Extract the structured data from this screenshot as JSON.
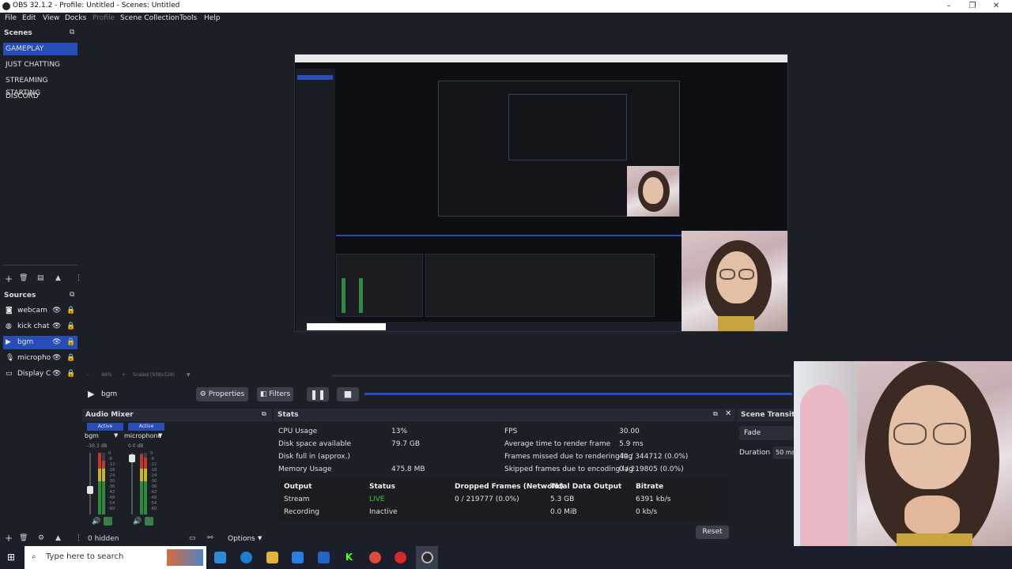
{
  "window": {
    "title": "OBS 32.1.2 - Profile: Untitled - Scenes: Untitled"
  },
  "menu": {
    "items": [
      "File",
      "Edit",
      "View",
      "Docks",
      "Profile",
      "Scene Collection",
      "Tools",
      "Help"
    ]
  },
  "scenes": {
    "title": "Scenes",
    "items": [
      {
        "label": "GAMEPLAY",
        "selected": true
      },
      {
        "label": "JUST CHATTING",
        "selected": false
      },
      {
        "label": "STREAMING STARTING",
        "selected": false
      },
      {
        "label": "DISCORD",
        "selected": false
      }
    ]
  },
  "sources": {
    "title": "Sources",
    "items": [
      {
        "label": "webcam",
        "icon": "camera-icon",
        "selected": false
      },
      {
        "label": "kick chat k",
        "icon": "browser-icon",
        "selected": false
      },
      {
        "label": "bgm",
        "icon": "play-icon",
        "selected": true
      },
      {
        "label": "micropho",
        "icon": "microphone-icon",
        "selected": false
      },
      {
        "label": "Display Ca",
        "icon": "monitor-icon",
        "selected": false
      }
    ],
    "hidden_count": "0 hidden"
  },
  "preview_info": {
    "zoom": "48%",
    "scaled": "Scaled (938x528)"
  },
  "media": {
    "source": "bgm",
    "properties": "Properties",
    "filters": "Filters"
  },
  "audio_mixer": {
    "title": "Audio Mixer",
    "channels": [
      {
        "name": "bgm",
        "status": "Active",
        "db": "-30.3 dB"
      },
      {
        "name": "microphone",
        "status": "Active",
        "db": "0.0 dB"
      }
    ],
    "scale": [
      "0",
      "-6",
      "-12",
      "-18",
      "-24",
      "-30",
      "-36",
      "-42",
      "-48",
      "-54",
      "-60"
    ],
    "options": "Options"
  },
  "stats": {
    "title": "Stats",
    "left": [
      {
        "label": "CPU Usage",
        "value": "13%"
      },
      {
        "label": "Disk space available",
        "value": "79.7 GB"
      },
      {
        "label": "Disk full in (approx.)",
        "value": ""
      },
      {
        "label": "Memory Usage",
        "value": "475.8 MB"
      }
    ],
    "right": [
      {
        "label": "FPS",
        "value": "30.00"
      },
      {
        "label": "Average time to render frame",
        "value": "5.9 ms"
      },
      {
        "label": "Frames missed due to rendering lag",
        "value": "40 / 344712 (0.0%)"
      },
      {
        "label": "Skipped frames due to encoding lag",
        "value": "0 / 219805 (0.0%)"
      }
    ],
    "table_headers": [
      "Output",
      "Status",
      "Dropped Frames (Network)",
      "Total Data Output",
      "Bitrate"
    ],
    "rows": [
      {
        "output": "Stream",
        "status": "LIVE",
        "dropped": "0 / 219777 (0.0%)",
        "total": "5.3 GB",
        "bitrate": "6391 kb/s"
      },
      {
        "output": "Recording",
        "status": "Inactive",
        "dropped": "",
        "total": "0.0 MiB",
        "bitrate": "0 kb/s"
      }
    ],
    "reset": "Reset"
  },
  "transitions": {
    "title": "Scene Transiti",
    "type": "Fade",
    "duration_label": "Duration",
    "duration_value": "50 ms"
  },
  "taskbar": {
    "search_placeholder": "Type here to search"
  },
  "colors": {
    "accent": "#284cb8",
    "live": "#3ec43e",
    "meter_green": "#2e8b3e",
    "meter_yellow": "#c9b52a",
    "meter_red": "#c0392b"
  }
}
